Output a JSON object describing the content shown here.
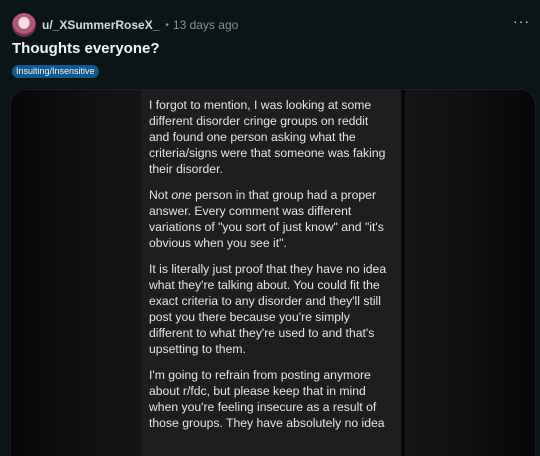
{
  "post": {
    "username": "u/_XSummerRoseX_",
    "separator": "•",
    "time": "13 days ago",
    "more_label": "···",
    "title": "Thoughts everyone?",
    "flair": "Insulting/Insensitive"
  },
  "image_text": {
    "p1": "I forgot to mention, I was looking at some different disorder cringe groups on reddit and found one person asking what the criteria/signs were that someone was faking their disorder.",
    "p2_before": "Not ",
    "p2_em": "one",
    "p2_after": " person in that group had a proper answer. Every comment was different variations of \"you sort of just know\" and \"it's obvious when you see it\".",
    "p3": "It is literally just proof that they have no idea what they're talking about. You could fit the exact criteria to any disorder and they'll still post you there because you're simply different to what they're used to and that's upsetting to them.",
    "p4": "I'm going to refrain from posting anymore about r/fdc, but please keep that in mind when you're feeling insecure as a result of those groups. They have absolutely no idea"
  },
  "colors": {
    "background": "#0b1416",
    "flair": "#0e5a8a",
    "panel": "#1e1e1e"
  }
}
